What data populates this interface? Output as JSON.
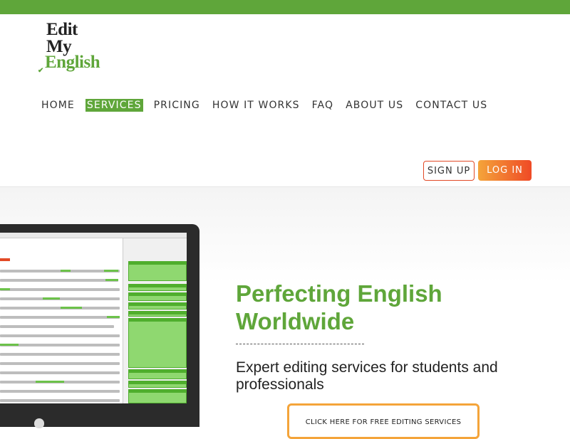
{
  "brand": {
    "line1": "Edit",
    "line2": "My",
    "line3": "English"
  },
  "nav": {
    "items": [
      {
        "label": "HOME"
      },
      {
        "label": "SERVICES"
      },
      {
        "label": "PRICING"
      },
      {
        "label": "HOW IT WORKS"
      },
      {
        "label": "FAQ"
      },
      {
        "label": "ABOUT US"
      },
      {
        "label": "CONTACT US"
      }
    ],
    "active": "SERVICES"
  },
  "auth": {
    "signup_label": "SIGN UP",
    "login_label": "LOG IN"
  },
  "hero": {
    "headline": "Perfecting English Worldwide",
    "subheadline": "Expert editing services for students and professionals",
    "cta_label": "CLICK HERE FOR FREE EDITING SERVICES"
  },
  "colors": {
    "brand_green": "#5fa63a",
    "accent_orange": "#f4a43a",
    "accent_red": "#ef4a26"
  },
  "icons": {
    "laptop": "laptop-icon",
    "apple": "apple-logo-icon"
  }
}
